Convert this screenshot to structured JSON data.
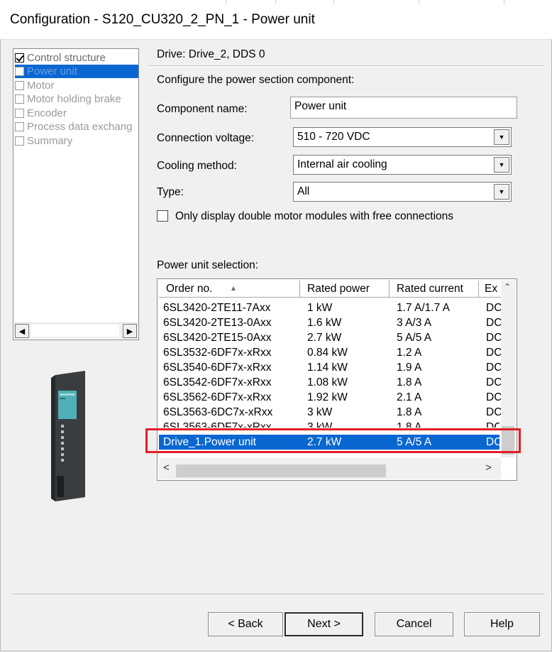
{
  "window": {
    "title": "Configuration - S120_CU320_2_PN_1 - Power unit"
  },
  "tree": {
    "items": [
      {
        "label": "Control structure",
        "checked": true
      },
      {
        "label": "Power unit",
        "selected": true
      },
      {
        "label": "Motor"
      },
      {
        "label": "Motor holding brake"
      },
      {
        "label": "Encoder"
      },
      {
        "label": "Process data exchang"
      },
      {
        "label": "Summary"
      }
    ]
  },
  "panel": {
    "drive_label": "Drive: Drive_2, DDS 0",
    "instruction": "Configure the power section component:",
    "component_name_label": "Component name:",
    "component_name_value": "Power unit",
    "connection_voltage_label": "Connection voltage:",
    "connection_voltage_value": "510 - 720 VDC",
    "cooling_method_label": "Cooling method:",
    "cooling_method_value": "Internal air cooling",
    "type_label": "Type:",
    "type_value": "All",
    "double_motor_checkbox_label": "Only display double motor modules with free connections",
    "selection_label": "Power unit selection:"
  },
  "table": {
    "columns": [
      "Order no.",
      "Rated power",
      "Rated current",
      "Ex"
    ],
    "rows": [
      [
        "6SL3420-2TE11-7Axx",
        "1 kW",
        "1.7 A/1.7 A",
        "DC"
      ],
      [
        "6SL3420-2TE13-0Axx",
        "1.6 kW",
        "3 A/3 A",
        "DC"
      ],
      [
        "6SL3420-2TE15-0Axx",
        "2.7 kW",
        "5 A/5 A",
        "DC"
      ],
      [
        "6SL3532-6DF7x-xRxx",
        "0.84 kW",
        "1.2 A",
        "DC"
      ],
      [
        "6SL3540-6DF7x-xRxx",
        "1.14 kW",
        "1.9 A",
        "DC"
      ],
      [
        "6SL3542-6DF7x-xRxx",
        "1.08 kW",
        "1.8 A",
        "DC"
      ],
      [
        "6SL3562-6DF7x-xRxx",
        "1.92 kW",
        "2.1 A",
        "DC"
      ],
      [
        "6SL3563-6DC7x-xRxx",
        "3 kW",
        "1.8 A",
        "DC"
      ],
      [
        "6SL3563-6DF7x-xRxx",
        "3 kW",
        "1.8 A",
        "DC"
      ]
    ],
    "selected_row": [
      "Drive_1.Power unit",
      "2.7 kW",
      "5 A/5 A",
      "DC"
    ]
  },
  "buttons": {
    "back": "< Back",
    "next": "Next >",
    "cancel": "Cancel",
    "help": "Help"
  },
  "colors": {
    "selection": "#0a67d1",
    "highlight_box": "#e21e26"
  },
  "icons": [
    "checkbox-icon",
    "scroll-left-icon",
    "scroll-right-icon",
    "dropdown-arrow-icon",
    "sort-ascending-icon",
    "scroll-up-icon",
    "power-unit-device-image"
  ]
}
